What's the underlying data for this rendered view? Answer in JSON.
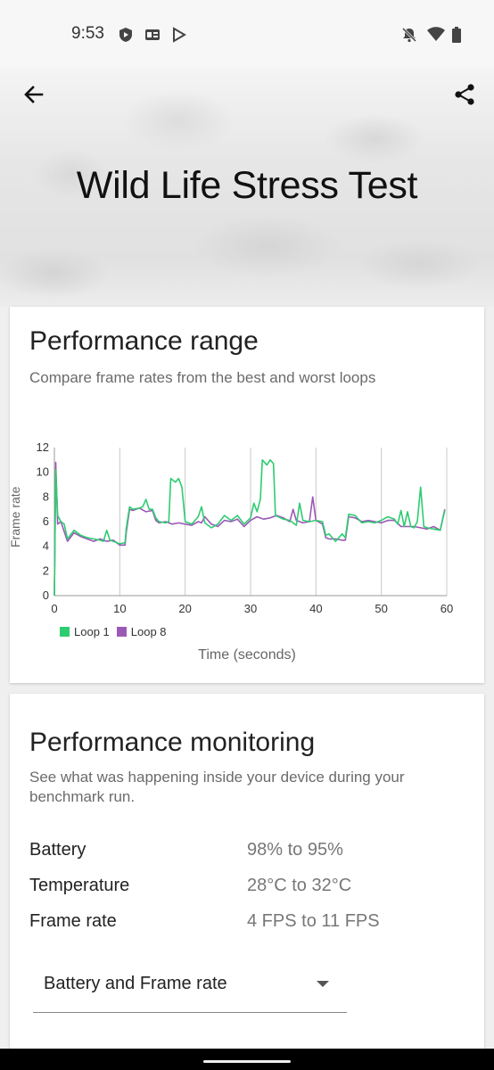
{
  "status_bar": {
    "time": "9:53",
    "left_icons": [
      "shield-play-icon",
      "news-icon",
      "play-store-icon"
    ],
    "right_icons": [
      "notifications-off-icon",
      "wifi-icon",
      "battery-icon"
    ]
  },
  "header": {
    "back_icon": "arrow-left-icon",
    "share_icon": "share-icon",
    "title": "Wild Life Stress Test"
  },
  "performance_range": {
    "title": "Performance range",
    "subtitle": "Compare frame rates from the best and worst loops"
  },
  "chart_data": {
    "type": "line",
    "title": "",
    "xlabel": "Time (seconds)",
    "ylabel": "Frame rate",
    "xlim": [
      0,
      60
    ],
    "ylim": [
      0,
      12
    ],
    "x_ticks": [
      0,
      10,
      20,
      30,
      40,
      50,
      60
    ],
    "y_ticks": [
      0,
      2,
      4,
      6,
      8,
      10,
      12
    ],
    "grid": "vertical",
    "legend_position": "bottom-left",
    "series": [
      {
        "name": "Loop 1",
        "color": "#2ecc71",
        "points": [
          [
            0,
            0
          ],
          [
            0.2,
            10.2
          ],
          [
            0.5,
            6.5
          ],
          [
            1,
            6
          ],
          [
            1.5,
            5.8
          ],
          [
            2,
            4.6
          ],
          [
            3,
            5.3
          ],
          [
            4,
            4.9
          ],
          [
            5,
            4.7
          ],
          [
            6,
            4.6
          ],
          [
            7,
            4.5
          ],
          [
            7.5,
            4.4
          ],
          [
            8,
            5.3
          ],
          [
            8.5,
            4.5
          ],
          [
            9,
            4.4
          ],
          [
            10,
            4.2
          ],
          [
            10.8,
            4.3
          ],
          [
            11,
            5.5
          ],
          [
            11.5,
            7.2
          ],
          [
            12,
            7.0
          ],
          [
            13,
            7.1
          ],
          [
            13.5,
            7.2
          ],
          [
            14,
            7.8
          ],
          [
            14.5,
            7.0
          ],
          [
            15,
            7.0
          ],
          [
            15.5,
            6.3
          ],
          [
            16,
            6.0
          ],
          [
            17,
            5.9
          ],
          [
            17.5,
            6.0
          ],
          [
            17.8,
            9.5
          ],
          [
            18.5,
            9.2
          ],
          [
            19,
            9.5
          ],
          [
            19.5,
            8.8
          ],
          [
            20,
            6.0
          ],
          [
            21,
            5.8
          ],
          [
            22,
            6.4
          ],
          [
            22.5,
            7.2
          ],
          [
            23,
            5.9
          ],
          [
            24,
            5.5
          ],
          [
            25,
            5.8
          ],
          [
            26,
            6.5
          ],
          [
            27,
            6.1
          ],
          [
            28,
            6.5
          ],
          [
            29,
            5.8
          ],
          [
            30,
            6.3
          ],
          [
            30.5,
            7.5
          ],
          [
            31,
            6.8
          ],
          [
            31.5,
            7.8
          ],
          [
            31.8,
            11.0
          ],
          [
            32.5,
            10.6
          ],
          [
            33,
            11.0
          ],
          [
            33.5,
            10.7
          ],
          [
            33.8,
            6.5
          ],
          [
            35,
            6.2
          ],
          [
            36,
            6.1
          ],
          [
            37,
            5.7
          ],
          [
            37.5,
            7.5
          ],
          [
            38,
            6.1
          ],
          [
            39,
            6.0
          ],
          [
            40,
            6.1
          ],
          [
            41,
            6.0
          ],
          [
            41.5,
            4.9
          ],
          [
            42,
            5.0
          ],
          [
            43,
            4.4
          ],
          [
            44,
            5.0
          ],
          [
            44.5,
            4.7
          ],
          [
            45,
            6.6
          ],
          [
            46,
            6.5
          ],
          [
            47,
            5.9
          ],
          [
            48,
            6.0
          ],
          [
            49,
            5.9
          ],
          [
            50,
            6.1
          ],
          [
            51,
            6.4
          ],
          [
            52,
            6.2
          ],
          [
            52.5,
            5.8
          ],
          [
            53,
            6.9
          ],
          [
            53.5,
            5.6
          ],
          [
            54,
            6.8
          ],
          [
            54.5,
            5.6
          ],
          [
            55,
            5.5
          ],
          [
            55.5,
            6.0
          ],
          [
            56,
            8.8
          ],
          [
            56.5,
            5.6
          ],
          [
            57,
            5.5
          ],
          [
            58,
            5.4
          ],
          [
            59,
            5.3
          ],
          [
            59.7,
            6.9
          ]
        ]
      },
      {
        "name": "Loop 8",
        "color": "#9b59b6",
        "points": [
          [
            0,
            0
          ],
          [
            0.2,
            10.8
          ],
          [
            0.5,
            5.8
          ],
          [
            1,
            6
          ],
          [
            1.5,
            5.2
          ],
          [
            2,
            4.4
          ],
          [
            3,
            5.1
          ],
          [
            4,
            4.8
          ],
          [
            5,
            4.6
          ],
          [
            6,
            4.4
          ],
          [
            7,
            4.6
          ],
          [
            8,
            4.4
          ],
          [
            9,
            4.5
          ],
          [
            10,
            4.1
          ],
          [
            10.8,
            4.1
          ],
          [
            11,
            5.2
          ],
          [
            11.5,
            7.0
          ],
          [
            12,
            6.9
          ],
          [
            13,
            7.1
          ],
          [
            14,
            6.8
          ],
          [
            15,
            6.9
          ],
          [
            15.5,
            6.1
          ],
          [
            16,
            5.9
          ],
          [
            17,
            6.0
          ],
          [
            18,
            5.8
          ],
          [
            19,
            5.9
          ],
          [
            20,
            5.8
          ],
          [
            21,
            5.7
          ],
          [
            22,
            6.0
          ],
          [
            22.5,
            5.9
          ],
          [
            23,
            6.4
          ],
          [
            24,
            5.8
          ],
          [
            25,
            5.6
          ],
          [
            26,
            6.1
          ],
          [
            27,
            6.0
          ],
          [
            28,
            6.2
          ],
          [
            29,
            5.6
          ],
          [
            30,
            6.1
          ],
          [
            31,
            6.4
          ],
          [
            32,
            6.2
          ],
          [
            33,
            6.3
          ],
          [
            34,
            6.5
          ],
          [
            35,
            6.3
          ],
          [
            36,
            6.0
          ],
          [
            36.5,
            7.0
          ],
          [
            37,
            6.1
          ],
          [
            38,
            5.9
          ],
          [
            39,
            6.0
          ],
          [
            39.5,
            8.0
          ],
          [
            40,
            6.1
          ],
          [
            41,
            5.8
          ],
          [
            41.5,
            4.7
          ],
          [
            42,
            4.6
          ],
          [
            43,
            4.6
          ],
          [
            44,
            4.5
          ],
          [
            44.5,
            4.5
          ],
          [
            45,
            6.4
          ],
          [
            46,
            6.3
          ],
          [
            47,
            6.0
          ],
          [
            48,
            6.1
          ],
          [
            49,
            6.0
          ],
          [
            50,
            5.9
          ],
          [
            51,
            6.1
          ],
          [
            52,
            6.1
          ],
          [
            53,
            5.6
          ],
          [
            54,
            5.6
          ],
          [
            55,
            5.6
          ],
          [
            56,
            5.5
          ],
          [
            57,
            5.4
          ],
          [
            58,
            5.6
          ],
          [
            59,
            5.3
          ],
          [
            59.7,
            7.0
          ]
        ]
      }
    ]
  },
  "performance_monitoring": {
    "title": "Performance monitoring",
    "subtitle": "See what was happening inside your device during your benchmark run.",
    "rows": [
      {
        "label": "Battery",
        "value": "98% to 95%"
      },
      {
        "label": "Temperature",
        "value": "28°C to 32°C"
      },
      {
        "label": "Frame rate",
        "value": "4 FPS to 11 FPS"
      }
    ],
    "dropdown": {
      "selected": "Battery and Frame rate",
      "icon": "dropdown-arrow-icon"
    }
  }
}
